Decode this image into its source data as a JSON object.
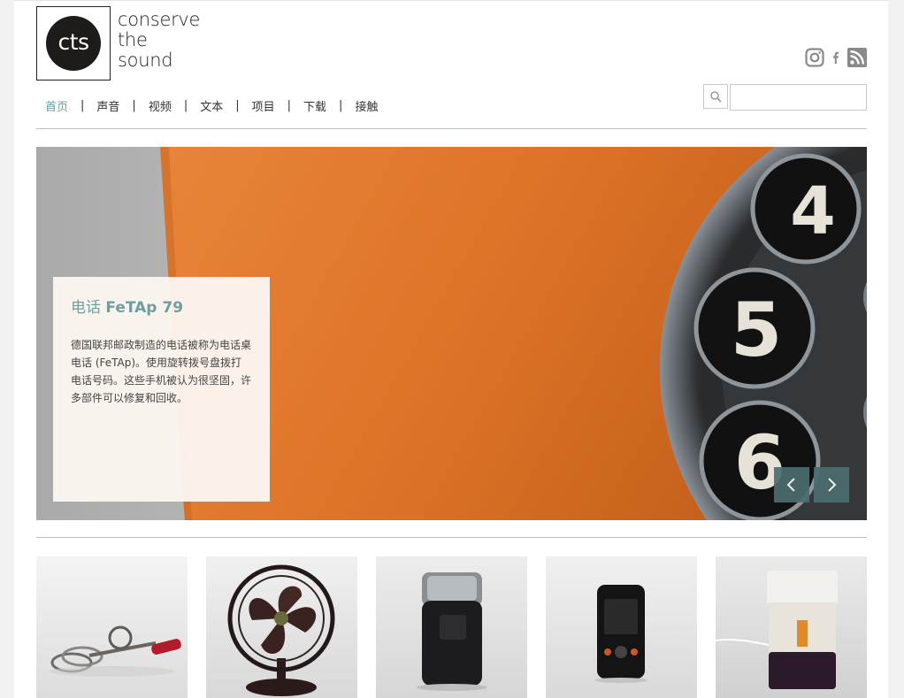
{
  "logo": {
    "mark": "cts",
    "lines": [
      "conserve",
      "the",
      "sound"
    ]
  },
  "social": [
    "instagram-icon",
    "facebook-icon",
    "rss-icon"
  ],
  "nav": [
    {
      "label": "首页",
      "active": true
    },
    {
      "label": "声音",
      "active": false
    },
    {
      "label": "视频",
      "active": false
    },
    {
      "label": "文本",
      "active": false
    },
    {
      "label": "项目",
      "active": false
    },
    {
      "label": "下载",
      "active": false
    },
    {
      "label": "接触",
      "active": false
    }
  ],
  "nav_separator": "|",
  "search": {
    "placeholder": "",
    "value": ""
  },
  "hero": {
    "title_prefix": "电话 ",
    "title_name": "FeTAp 79",
    "body": "德国联邦邮政制造的电话被称为电话桌电话 (FeTAp)。使用旋转拨号盘拨打电话号码。这些手机被认为很坚固，许多部件可以修复和回收。",
    "dial_digits": [
      "4",
      "5",
      "6"
    ],
    "prev_icon": "chevron-left-icon",
    "next_icon": "chevron-right-icon",
    "colors": {
      "orange": "#e0762b",
      "panel": "#4a6d6f",
      "title": "#6f9ea0"
    }
  },
  "thumbnails": [
    {
      "name": "egg-beater"
    },
    {
      "name": "desk-fan"
    },
    {
      "name": "electric-shaver"
    },
    {
      "name": "mobile-phone"
    },
    {
      "name": "coffee-grinder"
    }
  ]
}
